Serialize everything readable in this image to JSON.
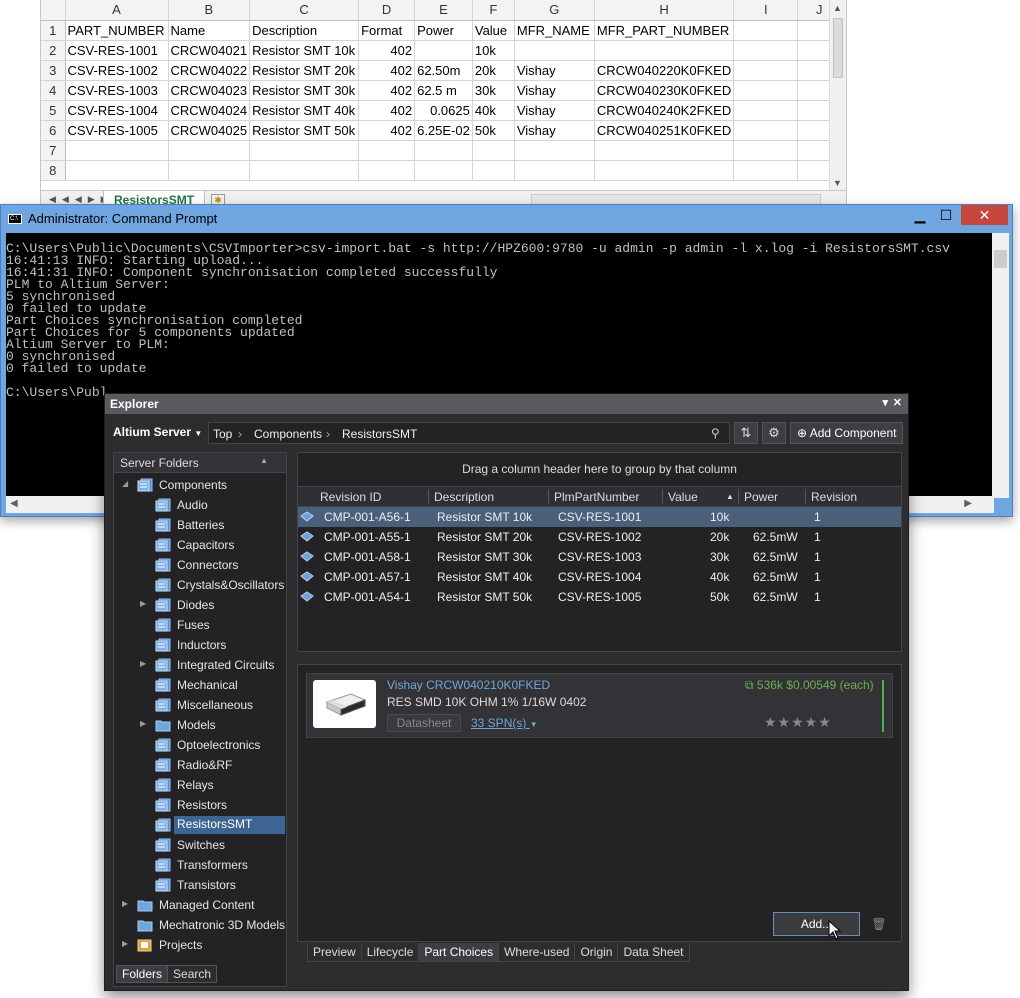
{
  "excel": {
    "columns": [
      "A",
      "B",
      "C",
      "D",
      "E",
      "F",
      "G",
      "H",
      "I",
      "J"
    ],
    "rows": [
      {
        "num": "1",
        "cells": [
          "PART_NUMBER",
          "Name",
          "Description",
          "Format",
          "Power",
          "Value",
          "MFR_NAME",
          "MFR_PART_NUMBER",
          "",
          ""
        ]
      },
      {
        "num": "2",
        "cells": [
          "CSV-RES-1001",
          "CRCW04021",
          "Resistor SMT 10k",
          "402",
          "",
          "10k",
          "",
          "",
          "",
          ""
        ]
      },
      {
        "num": "3",
        "cells": [
          "CSV-RES-1002",
          "CRCW04022",
          "Resistor SMT 20k",
          "402",
          "62.50m",
          "20k",
          "Vishay",
          "CRCW040220K0FKED",
          "",
          ""
        ]
      },
      {
        "num": "4",
        "cells": [
          "CSV-RES-1003",
          "CRCW04023",
          "Resistor SMT 30k",
          "402",
          "62.5 m",
          "30k",
          "Vishay",
          "CRCW040230K0FKED",
          "",
          ""
        ]
      },
      {
        "num": "5",
        "cells": [
          "CSV-RES-1004",
          "CRCW04024",
          "Resistor SMT 40k",
          "402",
          "0.0625",
          "40k",
          "Vishay",
          "CRCW040240K2FKED",
          "",
          ""
        ]
      },
      {
        "num": "6",
        "cells": [
          "CSV-RES-1005",
          "CRCW04025",
          "Resistor SMT 50k",
          "402",
          "6.25E-02",
          "50k",
          "Vishay",
          "CRCW040251K0FKED",
          "",
          ""
        ]
      },
      {
        "num": "7",
        "cells": [
          "",
          "",
          "",
          "",
          "",
          "",
          "",
          "",
          "",
          ""
        ]
      },
      {
        "num": "8",
        "cells": [
          "",
          "",
          "",
          "",
          "",
          "",
          "",
          "",
          "",
          ""
        ]
      }
    ],
    "sheet_tab": "ResistorsSMT"
  },
  "cmd": {
    "title": "Administrator: Command Prompt",
    "lines": [
      "C:\\Users\\Public\\Documents\\CSVImporter>csv-import.bat -s http://HPZ600:9780 -u admin -p admin -l x.log -i ResistorsSMT.csv",
      "16:41:13 INFO: Starting upload...",
      "16:41:31 INFO: Component synchronisation completed successfully",
      "PLM to Altium Server:",
      "5 synchronised",
      "0 failed to update",
      "Part Choices synchronisation completed",
      "Part Choices for 5 components updated",
      "Altium Server to PLM:",
      "0 synchronised",
      "0 failed to update",
      "",
      "C:\\Users\\Publ"
    ]
  },
  "explorer": {
    "title": "Explorer",
    "server": "Altium Server",
    "breadcrumb": [
      "Top",
      "Components",
      "ResistorsSMT"
    ],
    "add_component": "Add Component",
    "server_folders_label": "Server Folders",
    "tree": [
      {
        "label": "Components",
        "level": 0,
        "expanded": true,
        "expandable": true
      },
      {
        "label": "Audio",
        "level": 1
      },
      {
        "label": "Batteries",
        "level": 1
      },
      {
        "label": "Capacitors",
        "level": 1
      },
      {
        "label": "Connectors",
        "level": 1
      },
      {
        "label": "Crystals&Oscillators",
        "level": 1
      },
      {
        "label": "Diodes",
        "level": 1,
        "expandable": true
      },
      {
        "label": "Fuses",
        "level": 1
      },
      {
        "label": "Inductors",
        "level": 1
      },
      {
        "label": "Integrated Circuits",
        "level": 1,
        "expandable": true
      },
      {
        "label": "Mechanical",
        "level": 1
      },
      {
        "label": "Miscellaneous",
        "level": 1
      },
      {
        "label": "Models",
        "level": 1,
        "expandable": true,
        "plain": true
      },
      {
        "label": "Optoelectronics",
        "level": 1
      },
      {
        "label": "Radio&RF",
        "level": 1
      },
      {
        "label": "Relays",
        "level": 1
      },
      {
        "label": "Resistors",
        "level": 1
      },
      {
        "label": "ResistorsSMT",
        "level": 1,
        "selected": true
      },
      {
        "label": "Switches",
        "level": 1
      },
      {
        "label": "Transformers",
        "level": 1
      },
      {
        "label": "Transistors",
        "level": 1
      },
      {
        "label": "Managed Content",
        "level": 0,
        "expandable": true,
        "plain": true
      },
      {
        "label": "Mechatronic 3D Models",
        "level": 0,
        "plain": true
      },
      {
        "label": "Projects",
        "level": 0,
        "expandable": true,
        "project": true
      }
    ],
    "left_tabs": [
      "Folders",
      "Search"
    ],
    "group_hint": "Drag a column header here to group by that column",
    "grid_columns": [
      "Revision ID",
      "Description",
      "PlmPartNumber",
      "Value",
      "Power",
      "Revision"
    ],
    "grid_rows": [
      {
        "rev": "CMP-001-A56-1",
        "desc": "Resistor SMT 10k",
        "plm": "CSV-RES-1001",
        "value": "10k",
        "power": "",
        "revision": "1",
        "selected": true
      },
      {
        "rev": "CMP-001-A55-1",
        "desc": "Resistor SMT 20k",
        "plm": "CSV-RES-1002",
        "value": "20k",
        "power": "62.5mW",
        "revision": "1"
      },
      {
        "rev": "CMP-001-A58-1",
        "desc": "Resistor SMT 30k",
        "plm": "CSV-RES-1003",
        "value": "30k",
        "power": "62.5mW",
        "revision": "1"
      },
      {
        "rev": "CMP-001-A57-1",
        "desc": "Resistor SMT 40k",
        "plm": "CSV-RES-1004",
        "value": "40k",
        "power": "62.5mW",
        "revision": "1"
      },
      {
        "rev": "CMP-001-A54-1",
        "desc": "Resistor SMT 50k",
        "plm": "CSV-RES-1005",
        "value": "50k",
        "power": "62.5mW",
        "revision": "1"
      }
    ],
    "part": {
      "name": "Vishay CRCW040210K0FKED",
      "description": "RES SMD 10K OHM 1% 1/16W 0402",
      "datasheet": "Datasheet",
      "spn": "33 SPN(s)",
      "price": "536k  $0.00549 (each)",
      "stars": "★★★★★"
    },
    "add_button": "Add...",
    "bottom_tabs": [
      "Preview",
      "Lifecycle",
      "Part Choices",
      "Where-used",
      "Origin",
      "Data Sheet"
    ],
    "active_bottom_tab": "Part Choices",
    "colors": {
      "selection": "#3e6591",
      "link": "#6fa7d6",
      "price": "#6ab04c"
    }
  }
}
